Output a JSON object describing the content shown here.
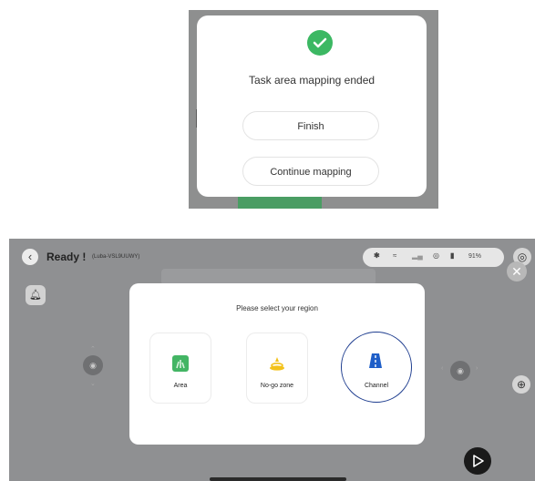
{
  "mapping_dialog": {
    "title": "Task area mapping ended",
    "finish_label": "Finish",
    "continue_label": "Continue mapping"
  },
  "app": {
    "status": "Ready !",
    "device_id": "(Luba-VSL9UUWY)",
    "battery": "91%",
    "colors": {
      "accent_green": "#3cb863",
      "channel_blue": "#1e3d8f"
    }
  },
  "region_dialog": {
    "title": "Please select your region",
    "options": [
      {
        "label": "Area",
        "icon": "grass-area-icon"
      },
      {
        "label": "No-go zone",
        "icon": "no-go-zone-icon"
      },
      {
        "label": "Channel",
        "icon": "channel-road-icon",
        "selected": true
      }
    ]
  }
}
